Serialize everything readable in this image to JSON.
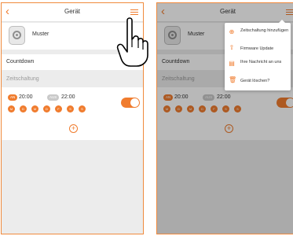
{
  "app": {
    "title": "Gerät",
    "back_icon": "back-chevron-icon",
    "menu_icon": "hamburger-menu-icon",
    "accent": "#f07c2e"
  },
  "device": {
    "name": "Muster",
    "icon": "smart-plug-icon"
  },
  "countdown_label": "Countdown",
  "section_label": "Zeitschaltung",
  "timer": {
    "on_badge": "AN",
    "on_time": "20:00",
    "off_badge": "AUS",
    "off_time": "22:00",
    "days": [
      "M",
      "D",
      "M",
      "D",
      "F",
      "S",
      "S"
    ],
    "enabled": true
  },
  "add_icon": "plus-circle-icon",
  "popup_menu": [
    {
      "icon": "plus-circle-icon",
      "label": "Zeitschaltung hinzufügen"
    },
    {
      "icon": "upload-arrow-icon",
      "label": "Firmware Update"
    },
    {
      "icon": "message-icon",
      "label": "Ihre Nachricht an uns"
    },
    {
      "icon": "trash-icon",
      "label": "Gerät löschen?"
    }
  ]
}
